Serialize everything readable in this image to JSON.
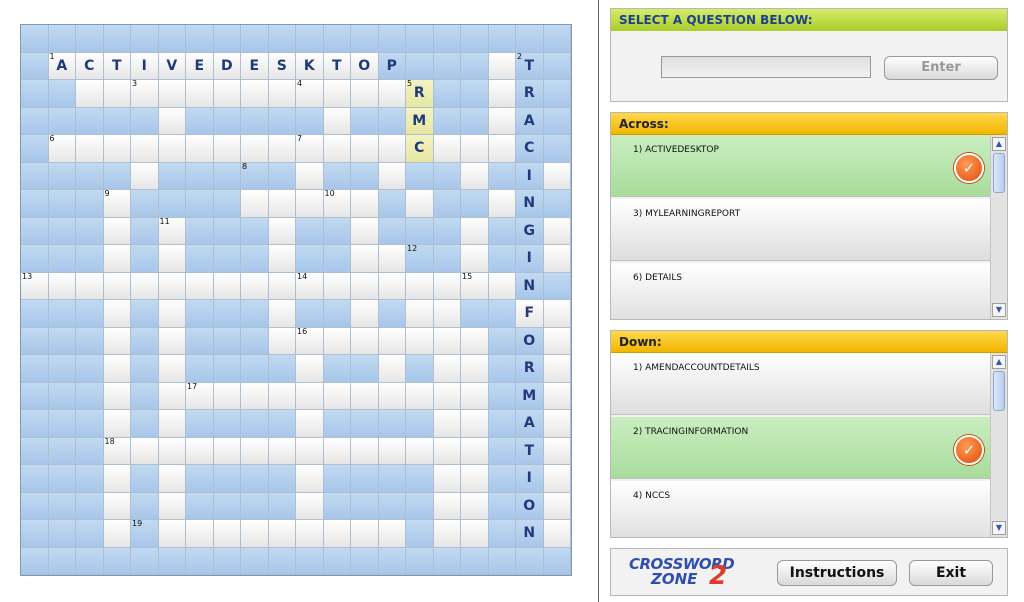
{
  "grid": {
    "rows": [
      "####################",
      "#AAAAAAAAAAAA####T##",
      "##AAAAAAAAAAAAR##R##",
      "#####W#####W##M##A##",
      "#AAAAAAAAWAAACAAAC##",
      "####W#####W##W##I##W",
      "###W####AAAAA#W##N##",
      "###W#W###W##W###G##W",
      "###W#W###W##AA##I##W",
      "AAAAAAAAAAAAAAAAAN##",
      "###W#W###W##W#WF##WW",
      "###W#W###WAAAAAAO##W",
      "###W#W####W##W#WR##W",
      "###W#WAAAAAAAAAAM##W",
      "###W#W####W####WA##W",
      "###AAAAAAAAAAAAAT##W",
      "###W#W####W####WI##W",
      "###W#W####W####WO##W",
      "###W#AAAAAAAAA#WN##W",
      "####################"
    ],
    "numbers": [
      {
        "r": 1,
        "c": 1,
        "n": "1"
      },
      {
        "r": 1,
        "c": 18,
        "n": "2"
      },
      {
        "r": 2,
        "c": 4,
        "n": "3"
      },
      {
        "r": 2,
        "c": 10,
        "n": "4"
      },
      {
        "r": 2,
        "c": 14,
        "n": "5"
      },
      {
        "r": 4,
        "c": 1,
        "n": "6"
      },
      {
        "r": 4,
        "c": 10,
        "n": "7"
      },
      {
        "r": 5,
        "c": 8,
        "n": "8"
      },
      {
        "r": 6,
        "c": 3,
        "n": "9"
      },
      {
        "r": 6,
        "c": 11,
        "n": "10"
      },
      {
        "r": 7,
        "c": 5,
        "n": "11"
      },
      {
        "r": 8,
        "c": 14,
        "n": "12"
      },
      {
        "r": 9,
        "c": 0,
        "n": "13"
      },
      {
        "r": 9,
        "c": 10,
        "n": "14"
      },
      {
        "r": 9,
        "c": 16,
        "n": "15"
      },
      {
        "r": 11,
        "c": 10,
        "n": "16"
      },
      {
        "r": 13,
        "c": 6,
        "n": "17"
      },
      {
        "r": 15,
        "c": 3,
        "n": "18"
      },
      {
        "r": 18,
        "c": 4,
        "n": "19"
      }
    ],
    "letters": [
      {
        "r": 1,
        "c": 1,
        "ch": "A"
      },
      {
        "r": 1,
        "c": 2,
        "ch": "C"
      },
      {
        "r": 1,
        "c": 3,
        "ch": "T"
      },
      {
        "r": 1,
        "c": 4,
        "ch": "I"
      },
      {
        "r": 1,
        "c": 5,
        "ch": "V"
      },
      {
        "r": 1,
        "c": 6,
        "ch": "E"
      },
      {
        "r": 1,
        "c": 7,
        "ch": "D"
      },
      {
        "r": 1,
        "c": 8,
        "ch": "E"
      },
      {
        "r": 1,
        "c": 9,
        "ch": "S"
      },
      {
        "r": 1,
        "c": 10,
        "ch": "K"
      },
      {
        "r": 1,
        "c": 11,
        "ch": "T"
      },
      {
        "r": 1,
        "c": 12,
        "ch": "O"
      },
      {
        "r": 1,
        "c": 13,
        "ch": "P"
      },
      {
        "r": 1,
        "c": 18,
        "ch": "T"
      },
      {
        "r": 2,
        "c": 18,
        "ch": "R"
      },
      {
        "r": 3,
        "c": 18,
        "ch": "A"
      },
      {
        "r": 4,
        "c": 18,
        "ch": "C"
      },
      {
        "r": 5,
        "c": 18,
        "ch": "I"
      },
      {
        "r": 6,
        "c": 18,
        "ch": "N"
      },
      {
        "r": 7,
        "c": 18,
        "ch": "G"
      },
      {
        "r": 8,
        "c": 18,
        "ch": "I"
      },
      {
        "r": 9,
        "c": 18,
        "ch": "N"
      },
      {
        "r": 10,
        "c": 18,
        "ch": "F"
      },
      {
        "r": 11,
        "c": 18,
        "ch": "O"
      },
      {
        "r": 12,
        "c": 18,
        "ch": "R"
      },
      {
        "r": 13,
        "c": 18,
        "ch": "M"
      },
      {
        "r": 14,
        "c": 18,
        "ch": "A"
      },
      {
        "r": 15,
        "c": 18,
        "ch": "T"
      },
      {
        "r": 16,
        "c": 18,
        "ch": "I"
      },
      {
        "r": 17,
        "c": 18,
        "ch": "O"
      },
      {
        "r": 18,
        "c": 18,
        "ch": "N"
      },
      {
        "r": 2,
        "c": 14,
        "ch": "R"
      },
      {
        "r": 3,
        "c": 14,
        "ch": "M"
      },
      {
        "r": 4,
        "c": 14,
        "ch": "C"
      }
    ],
    "highlight": [
      {
        "r": 2,
        "c": 14
      },
      {
        "r": 3,
        "c": 14
      },
      {
        "r": 4,
        "c": 14
      }
    ]
  },
  "question_panel": {
    "title": "SELECT A QUESTION BELOW:",
    "answer_value": "",
    "enter_label": "Enter"
  },
  "across": {
    "title": "Across:",
    "items": [
      {
        "label": "1)   ACTIVEDESKTOP",
        "done": true
      },
      {
        "label": "3)   MYLEARNINGREPORT",
        "done": false
      },
      {
        "label": "6)   DETAILS",
        "done": false
      }
    ]
  },
  "down": {
    "title": "Down:",
    "items": [
      {
        "label": "1)   AMENDACCOUNTDETAILS",
        "done": false
      },
      {
        "label": "2)   TRACINGINFORMATION",
        "done": true
      },
      {
        "label": "4)   NCCS",
        "done": false
      }
    ]
  },
  "logo": {
    "line1": "CROSSWORD",
    "line2": "ZONE",
    "mark": "2"
  },
  "buttons": {
    "instructions": "Instructions",
    "exit": "Exit"
  },
  "icons": {
    "check": "check-icon",
    "scroll_up": "scroll-up-icon",
    "scroll_down": "scroll-down-icon"
  },
  "colors": {
    "cell_blue": "#b4d0ee",
    "cell_white": "#f4f4f4",
    "letter": "#223a7a",
    "header_green": "#a9cc29",
    "header_yellow": "#f2b600",
    "done_green": "#b8e6ad"
  }
}
